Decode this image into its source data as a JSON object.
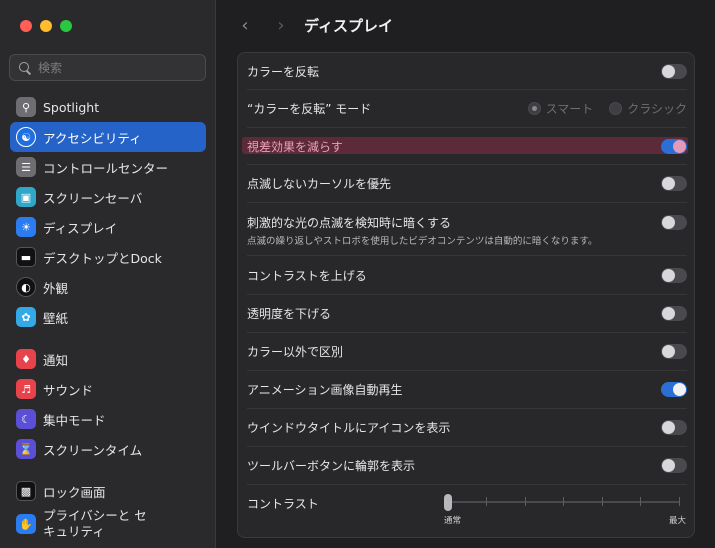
{
  "window": {
    "traffic_lights": {
      "close": "#ff5f57",
      "minimize": "#febc2e",
      "zoom": "#28c840"
    }
  },
  "search": {
    "placeholder": "検索"
  },
  "sidebar": {
    "items": [
      {
        "label": "Spotlight",
        "icon": "spotlight-icon",
        "color": "#6e6e72"
      },
      {
        "label": "アクセシビリティ",
        "icon": "accessibility-icon",
        "color": "#1f6fe0",
        "active": true
      },
      {
        "label": "コントロールセンター",
        "icon": "control-center-icon",
        "color": "#6e6e72"
      },
      {
        "label": "スクリーンセーバ",
        "icon": "screensaver-icon",
        "color": "#2fa7c8"
      },
      {
        "label": "ディスプレイ",
        "icon": "display-icon",
        "color": "#2b7cf0"
      },
      {
        "label": "デスクトップとDock",
        "icon": "dock-icon",
        "color": "#111113"
      },
      {
        "label": "外観",
        "icon": "appearance-icon",
        "color": "#111113"
      },
      {
        "label": "壁紙",
        "icon": "wallpaper-icon",
        "color": "#35a8e6"
      },
      {
        "label": "通知",
        "icon": "notifications-icon",
        "color": "#e8434b"
      },
      {
        "label": "サウンド",
        "icon": "sound-icon",
        "color": "#e8434b"
      },
      {
        "label": "集中モード",
        "icon": "focus-icon",
        "color": "#5b4fd6"
      },
      {
        "label": "スクリーンタイム",
        "icon": "screentime-icon",
        "color": "#5b4fd6"
      },
      {
        "label": "ロック画面",
        "icon": "lock-screen-icon",
        "color": "#111113"
      },
      {
        "label": "プライバシーと セキュリティ",
        "icon": "privacy-icon",
        "color": "#2b7cf0"
      }
    ]
  },
  "toolbar": {
    "back": "‹",
    "forward": "›",
    "title": "ディスプレイ"
  },
  "settings": {
    "invert_colors": {
      "label": "カラーを反転",
      "on": false
    },
    "invert_mode": {
      "label": "“カラーを反転” モード",
      "options": [
        "スマート",
        "クラシック"
      ],
      "selected": "スマート"
    },
    "reduce_motion": {
      "label": "視差効果を減らす",
      "on": true
    },
    "prefer_non_blinking_cursor": {
      "label": "点滅しないカーソルを優先",
      "on": false
    },
    "dim_flashing_lights": {
      "label": "刺激的な光の点滅を検知時に暗くする",
      "description": "点滅の繰り返しやストロボを使用したビデオコンテンツは自動的に暗くなります。",
      "on": false
    },
    "increase_contrast": {
      "label": "コントラストを上げる",
      "on": false
    },
    "reduce_transparency": {
      "label": "透明度を下げる",
      "on": false
    },
    "differentiate_without_color": {
      "label": "カラー以外で区別",
      "on": false
    },
    "autoplay_animated_images": {
      "label": "アニメーション画像自動再生",
      "on": true
    },
    "show_window_title_icons": {
      "label": "ウインドウタイトルにアイコンを表示",
      "on": false
    },
    "show_toolbar_button_shapes": {
      "label": "ツールバーボタンに輪郭を表示",
      "on": false
    },
    "contrast": {
      "label": "コントラスト",
      "min_label": "通常",
      "max_label": "最大",
      "value": 0
    }
  }
}
